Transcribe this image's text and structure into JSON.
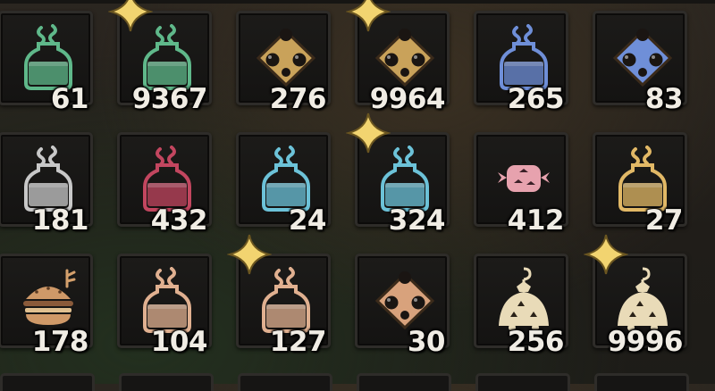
{
  "inventory": {
    "slots": [
      {
        "count": "61",
        "item": "green-potion-icon",
        "shape": "flask",
        "color": "#5fb88a",
        "starred": false
      },
      {
        "count": "9367",
        "item": "green-potion-icon",
        "shape": "flask",
        "color": "#5fb88a",
        "starred": true
      },
      {
        "count": "276",
        "item": "gold-bomb-icon",
        "shape": "bomb",
        "color": "#c9a25a",
        "starred": false
      },
      {
        "count": "9964",
        "item": "gold-bomb-icon",
        "shape": "bomb",
        "color": "#c9a25a",
        "starred": true
      },
      {
        "count": "265",
        "item": "blue-potion-icon",
        "shape": "flask",
        "color": "#6f8fd8",
        "starred": false
      },
      {
        "count": "83",
        "item": "blue-bomb-icon",
        "shape": "bomb",
        "color": "#6f8fd8",
        "starred": false
      },
      {
        "count": "181",
        "item": "white-potion-icon",
        "shape": "flask",
        "color": "#c8c8c8",
        "starred": false
      },
      {
        "count": "432",
        "item": "red-potion-icon",
        "shape": "flask",
        "color": "#c2465f",
        "starred": false
      },
      {
        "count": "24",
        "item": "cyan-potion-icon",
        "shape": "flask",
        "color": "#6cc2d8",
        "starred": false
      },
      {
        "count": "324",
        "item": "cyan-potion-icon",
        "shape": "flask",
        "color": "#6cc2d8",
        "starred": true
      },
      {
        "count": "412",
        "item": "pink-candy-icon",
        "shape": "candy",
        "color": "#e7a2ae",
        "starred": false
      },
      {
        "count": "27",
        "item": "yellow-potion-icon",
        "shape": "flask",
        "color": "#e1b866",
        "starred": false
      },
      {
        "count": "178",
        "item": "sandwich-icon",
        "shape": "burger",
        "color": "#cf9968",
        "starred": false
      },
      {
        "count": "104",
        "item": "tan-potion-icon",
        "shape": "flask",
        "color": "#e0b090",
        "starred": false
      },
      {
        "count": "127",
        "item": "tan-potion-icon",
        "shape": "flask",
        "color": "#e0b090",
        "starred": true
      },
      {
        "count": "30",
        "item": "tan-bomb-icon",
        "shape": "bomb",
        "color": "#d8a27c",
        "starred": false
      },
      {
        "count": "256",
        "item": "cream-lamp-icon",
        "shape": "lamp",
        "color": "#e9dbb8",
        "starred": false
      },
      {
        "count": "9996",
        "item": "cream-lamp-icon",
        "shape": "lamp",
        "color": "#e9dbb8",
        "starred": true
      }
    ],
    "star_color": "#f2d470"
  }
}
